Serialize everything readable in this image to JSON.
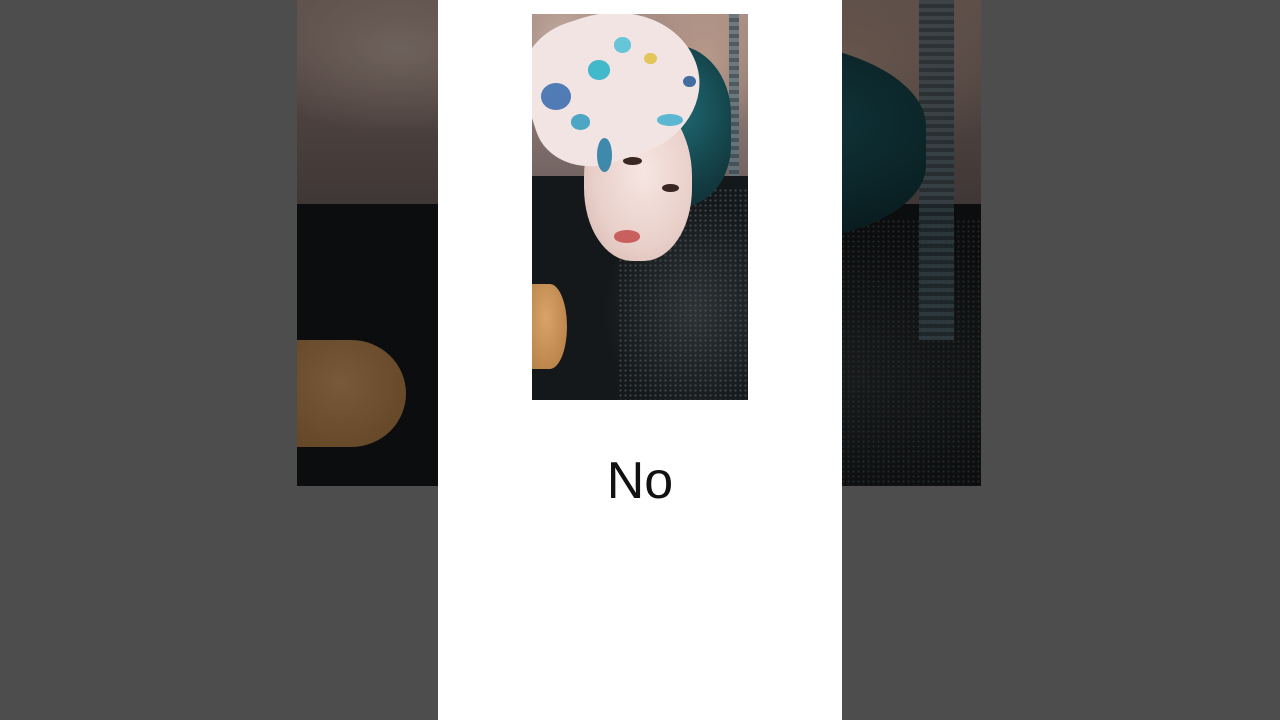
{
  "video": {
    "caption": "No",
    "background_color": "#4d4d4d",
    "panel_color": "#ffffff",
    "caption_color": "#111111"
  }
}
